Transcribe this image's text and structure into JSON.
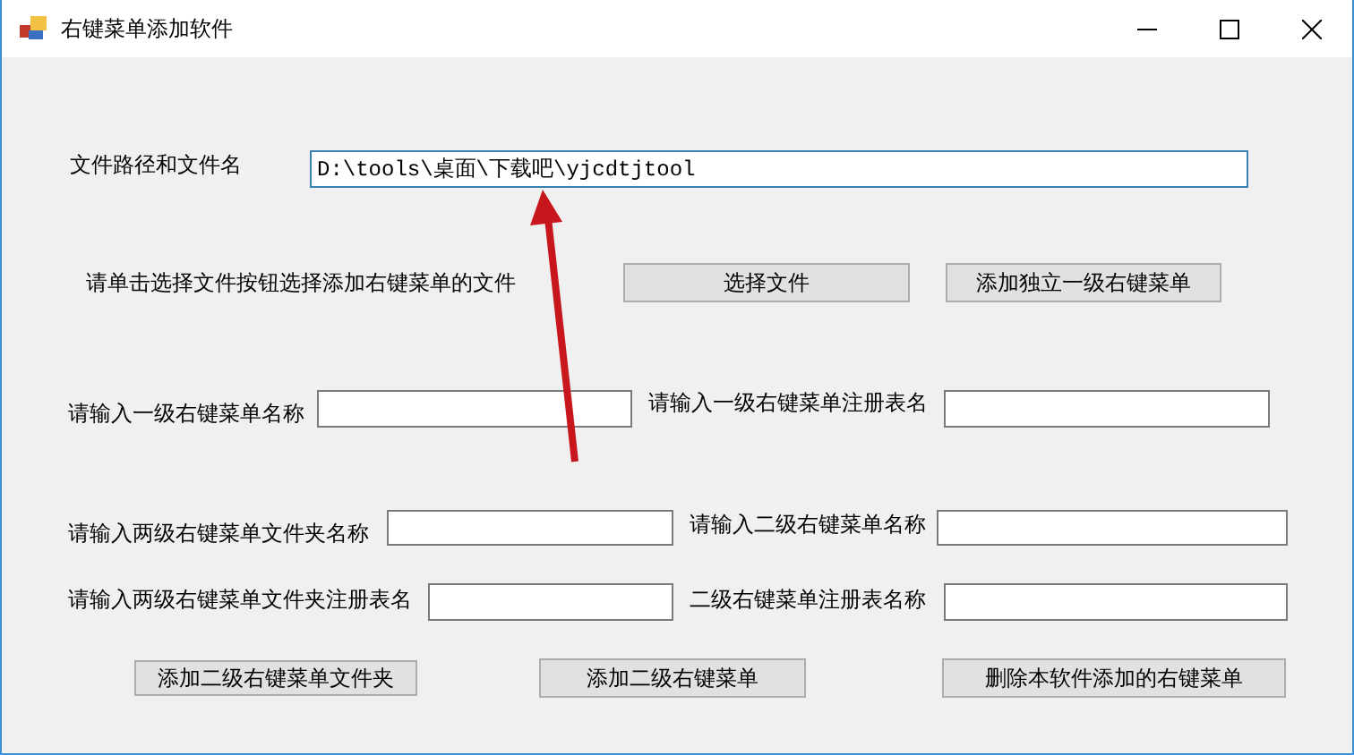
{
  "window": {
    "title": "右键菜单添加软件"
  },
  "file_path": {
    "label": "文件路径和文件名",
    "value": "D:\\tools\\桌面\\下载吧\\yjcdtjtool"
  },
  "choose_hint": "请单击选择文件按钮选择添加右键菜单的文件",
  "top_buttons": [
    "选择文件",
    "添加独立一级右键菜单"
  ],
  "fields": [
    {
      "label": "请输入一级右键菜单名称"
    },
    {
      "label": "请输入一级右键菜单注册表名"
    },
    {
      "label": "请输入两级右键菜单文件夹名称"
    },
    {
      "label": "请输入二级右键菜单名称"
    },
    {
      "label": "请输入两级右键菜单文件夹注册表名"
    },
    {
      "label": "二级右键菜单注册表名称"
    }
  ],
  "bottom_buttons": [
    "添加二级右键菜单文件夹",
    "添加二级右键菜单",
    "删除本软件添加的右键菜单"
  ]
}
